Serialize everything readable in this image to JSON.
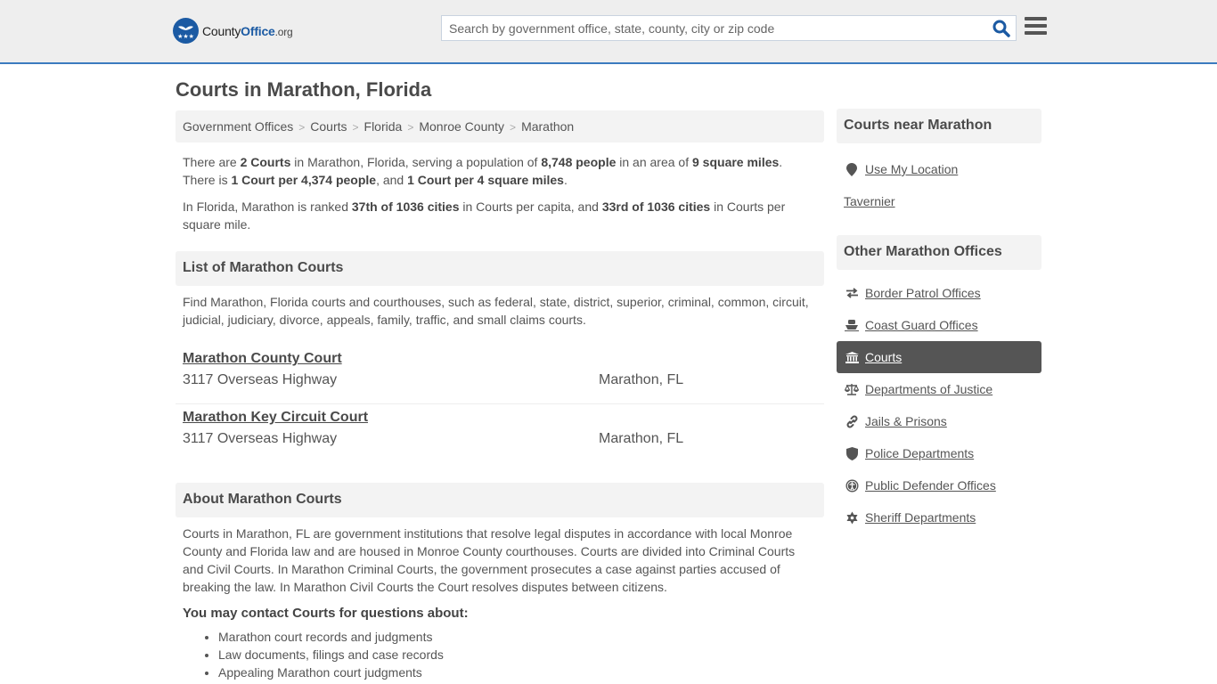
{
  "header": {
    "logo": {
      "part1": "County",
      "part2": "Office",
      "part3": ".org"
    },
    "search": {
      "placeholder": "Search by government office, state, county, city or zip code",
      "value": ""
    }
  },
  "page_title": "Courts in Marathon, Florida",
  "breadcrumb": [
    "Government Offices",
    "Courts",
    "Florida",
    "Monroe County",
    "Marathon"
  ],
  "summary": {
    "p1": [
      {
        "t": "There are ",
        "b": false
      },
      {
        "t": "2 Courts",
        "b": true
      },
      {
        "t": " in Marathon, Florida, serving a population of ",
        "b": false
      },
      {
        "t": "8,748 people",
        "b": true
      },
      {
        "t": " in an area of ",
        "b": false
      },
      {
        "t": "9 square miles",
        "b": true
      },
      {
        "t": ". There is ",
        "b": false
      },
      {
        "t": "1 Court per 4,374 people",
        "b": true
      },
      {
        "t": ", and ",
        "b": false
      },
      {
        "t": "1 Court per 4 square miles",
        "b": true
      },
      {
        "t": ".",
        "b": false
      }
    ],
    "p2": [
      {
        "t": "In Florida, Marathon is ranked ",
        "b": false
      },
      {
        "t": "37th of 1036 cities",
        "b": true
      },
      {
        "t": " in Courts per capita, and ",
        "b": false
      },
      {
        "t": "33rd of 1036 cities",
        "b": true
      },
      {
        "t": " in Courts per square mile.",
        "b": false
      }
    ]
  },
  "list_section": {
    "title": "List of Marathon Courts",
    "description": "Find Marathon, Florida courts and courthouses, such as federal, state, district, superior, criminal, common, circuit, judicial, judiciary, divorce, appeals, family, traffic, and small claims courts.",
    "courts": [
      {
        "name": "Marathon County Court",
        "address": "3117 Overseas Highway",
        "city": "Marathon, FL"
      },
      {
        "name": "Marathon Key Circuit Court",
        "address": "3117 Overseas Highway",
        "city": "Marathon, FL"
      }
    ]
  },
  "about_section": {
    "title": "About Marathon Courts",
    "body": "Courts in Marathon, FL are government institutions that resolve legal disputes in accordance with local Monroe County and Florida law and are housed in Monroe County courthouses. Courts are divided into Criminal Courts and Civil Courts. In Marathon Criminal Courts, the government prosecutes a case against parties accused of breaking the law. In Marathon Civil Courts the Court resolves disputes between citizens.",
    "contact_heading": "You may contact Courts for questions about:",
    "bullets": [
      "Marathon court records and judgments",
      "Law documents, filings and case records",
      "Appealing Marathon court judgments"
    ]
  },
  "sidebar": {
    "near_title": "Courts near Marathon",
    "use_location": "Use My Location",
    "nearby": [
      "Tavernier"
    ],
    "other_title": "Other Marathon Offices",
    "offices": [
      {
        "label": "Border Patrol Offices",
        "icon": "arrows-exchange-icon",
        "active": false
      },
      {
        "label": "Coast Guard Offices",
        "icon": "ship-icon",
        "active": false
      },
      {
        "label": "Courts",
        "icon": "courthouse-icon",
        "active": true
      },
      {
        "label": "Departments of Justice",
        "icon": "scales-icon",
        "active": false
      },
      {
        "label": "Jails & Prisons",
        "icon": "chain-link-icon",
        "active": false
      },
      {
        "label": "Police Departments",
        "icon": "shield-icon",
        "active": false
      },
      {
        "label": "Public Defender Offices",
        "icon": "person-circle-icon",
        "active": false
      },
      {
        "label": "Sheriff Departments",
        "icon": "sheriff-star-icon",
        "active": false
      }
    ]
  },
  "colors": {
    "brand_blue": "#1b5aa3",
    "header_border": "#3b7bbf",
    "active_item_bg": "#555555"
  }
}
